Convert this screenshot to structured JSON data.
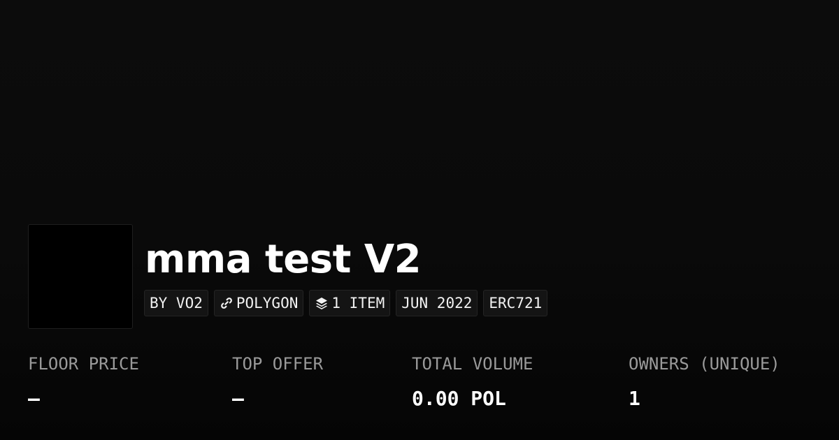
{
  "collection": {
    "name": "mma test V2"
  },
  "tags": [
    {
      "label": "BY VO2",
      "icon": null
    },
    {
      "label": "POLYGON",
      "icon": "chain-link-icon"
    },
    {
      "label": "1 ITEM",
      "icon": "layers-icon"
    },
    {
      "label": "JUN 2022",
      "icon": null
    },
    {
      "label": "ERC721",
      "icon": null
    }
  ],
  "stats": [
    {
      "label": "FLOOR PRICE",
      "value": "–"
    },
    {
      "label": "TOP OFFER",
      "value": "–"
    },
    {
      "label": "TOTAL VOLUME",
      "value": "0.00 POL"
    },
    {
      "label": "OWNERS (UNIQUE)",
      "value": "1"
    }
  ],
  "colors": {
    "background": "#0b0b0b",
    "pill_background": "#141414",
    "pill_border": "#242424",
    "label_text": "#9a9a9a",
    "value_text": "#ffffff"
  }
}
